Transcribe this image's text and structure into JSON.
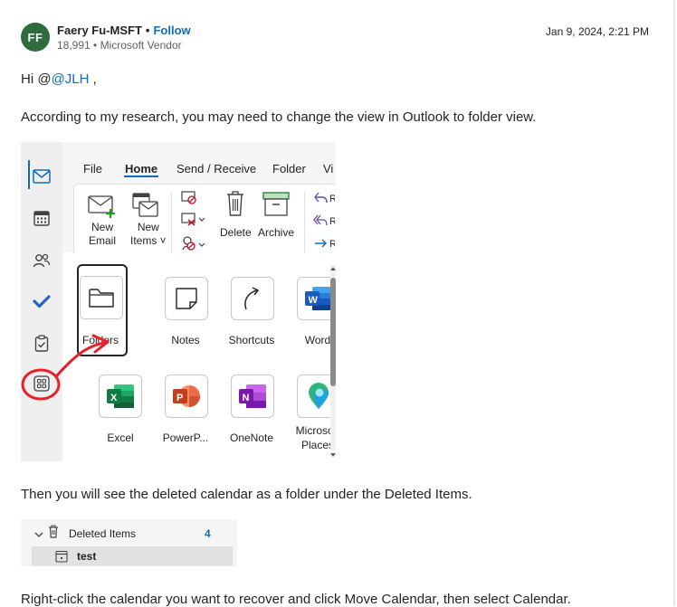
{
  "author": {
    "initials": "FF",
    "name": "Faery Fu-MSFT",
    "separator": "•",
    "follow_label": "Follow",
    "meta": "18,991 • Microsoft Vendor",
    "date": "Jan 9, 2024, 2:21 PM"
  },
  "body": {
    "greeting_prefix": "Hi @",
    "mention": "@JLH",
    "greeting_suffix": " ,",
    "para1": "According to my research, you may need to change the view in Outlook to folder view.",
    "para2": "Then you will see the deleted calendar as a folder under the Deleted Items.",
    "para3": "Right-click the calendar you want to recover and click Move Calendar, then select Calendar."
  },
  "outlook": {
    "menu": [
      "File",
      "Home",
      "Send / Receive",
      "Folder",
      "Vi"
    ],
    "active_menu": "Home",
    "ribbon": {
      "new_email_1": "New",
      "new_email_2": "Email",
      "new_items_1": "New",
      "new_items_2": "Items ˅",
      "delete": "Delete",
      "archive": "Archive",
      "reply_partial": "R"
    },
    "apps": [
      {
        "label": "Folders",
        "icon": "folder-icon"
      },
      {
        "label": "Notes",
        "icon": "note-icon"
      },
      {
        "label": "Shortcuts",
        "icon": "shortcut-arrow-icon"
      },
      {
        "label": "Word",
        "icon": "word-icon"
      },
      {
        "label": "Excel",
        "icon": "excel-icon"
      },
      {
        "label": "PowerP...",
        "icon": "powerpoint-icon"
      },
      {
        "label": "OneNote",
        "icon": "onenote-icon"
      },
      {
        "label_1": "Microsoft",
        "label_2": "Places",
        "icon": "places-icon"
      }
    ],
    "colors": {
      "accent": "#0f6cbd",
      "annotation": "#e8202a"
    }
  },
  "folder_pane": {
    "deleted_items": "Deleted Items",
    "deleted_count": "4",
    "calendar_name": "test"
  }
}
